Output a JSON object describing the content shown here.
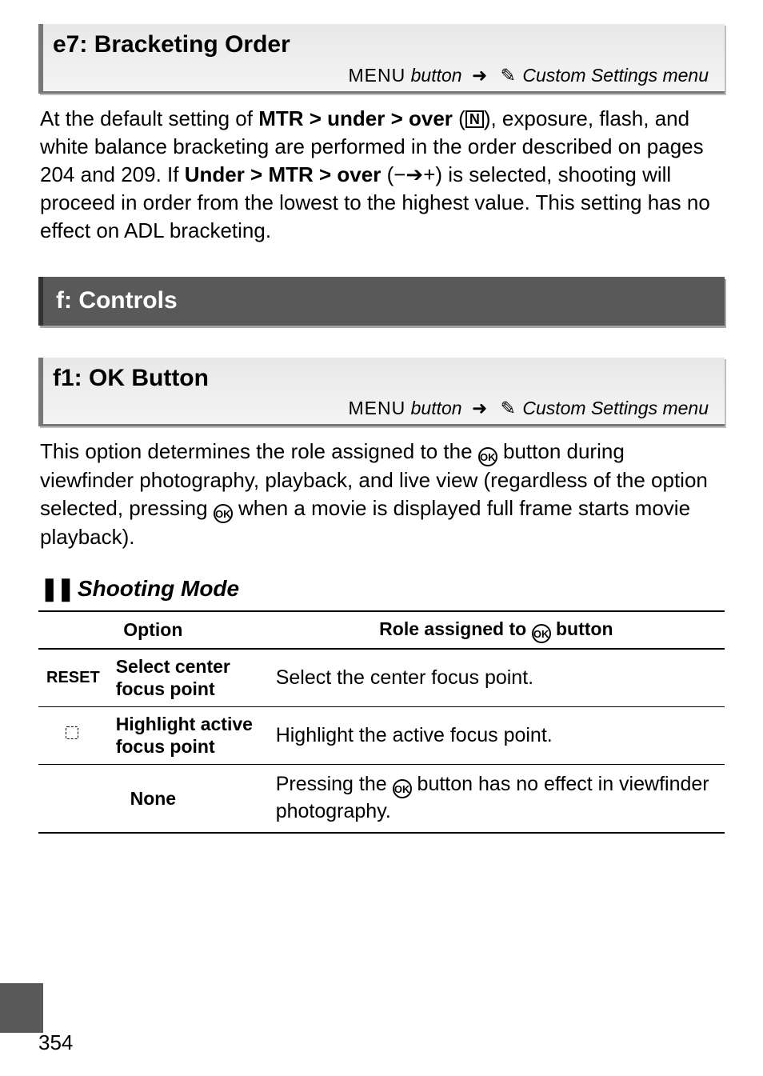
{
  "e7": {
    "title": "e7: Bracketing Order",
    "menu_label": "MENU",
    "menu_button_word": "button",
    "menu_dest": "Custom Settings menu",
    "body_pre": "At the default setting of ",
    "opt1": "MTR > under > over",
    "body_mid1": ", exposure, flash, and white balance bracketing are performed in the order described on pages 204 and 209.  If ",
    "opt2": "Under > MTR > over",
    "body_mid2": " is selected, shooting will proceed in order from the lowest to the highest value.  This setting has no effect on ADL bracketing.",
    "glyph_n": "N",
    "glyph_arrows": "−➔+"
  },
  "f_group": {
    "title": "f: Controls"
  },
  "f1": {
    "title": "f1: OK Button",
    "menu_label": "MENU",
    "menu_button_word": "button",
    "menu_dest": "Custom Settings menu",
    "body_pre": "This option determines the role assigned to the ",
    "body_mid": " button during viewfinder photography, playback, and live view (regardless of the option selected, pressing ",
    "body_post": " when a movie is displayed full frame starts movie playback).",
    "ok": "OK"
  },
  "shooting": {
    "heading": "Shooting Mode",
    "col_option": "Option",
    "col_role_pre": "Role assigned to ",
    "col_role_post": " button",
    "rows": [
      {
        "icon": "RESET",
        "name": "Select center focus point",
        "role": "Select the center focus point."
      },
      {
        "icon": "HL",
        "name": "Highlight active focus point",
        "role": "Highlight the active focus point."
      },
      {
        "icon": "",
        "name": "None",
        "role_pre": "Pressing the ",
        "role_post": " button has no effect in viewfinder photography."
      }
    ]
  },
  "page": "354"
}
